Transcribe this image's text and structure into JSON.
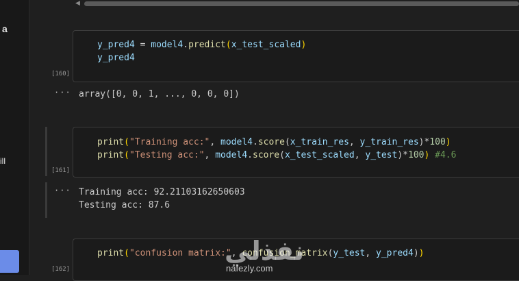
{
  "sidebar": {
    "fragment_top": "a",
    "fragment_mid": "ill"
  },
  "cells": [
    {
      "count": "[160]",
      "lines": [
        [
          [
            "y_pred4",
            "var"
          ],
          [
            " = ",
            ""
          ],
          [
            "model4",
            "var"
          ],
          [
            ".",
            ""
          ],
          [
            "predict",
            "fn"
          ],
          [
            "(",
            "pn"
          ],
          [
            "x_test_scaled",
            "var"
          ],
          [
            ")",
            "pn"
          ]
        ],
        [
          [
            "y_pred4",
            "var"
          ]
        ]
      ],
      "output": [
        "array([0, 0, 1, ..., 0, 0, 0])"
      ]
    },
    {
      "count": "[161]",
      "lines": [
        [
          [
            "print",
            "fn"
          ],
          [
            "(",
            "pn"
          ],
          [
            "\"Training acc:\"",
            "str"
          ],
          [
            ", ",
            ""
          ],
          [
            "model4",
            "var"
          ],
          [
            ".",
            ""
          ],
          [
            "score",
            "fn"
          ],
          [
            "(",
            ""
          ],
          [
            "x_train_res",
            "var"
          ],
          [
            ", ",
            ""
          ],
          [
            "y_train_res",
            "var"
          ],
          [
            ")",
            ""
          ],
          [
            "*",
            ""
          ],
          [
            "100",
            "num"
          ],
          [
            ")",
            "pn"
          ]
        ],
        [
          [
            "print",
            "fn"
          ],
          [
            "(",
            "pn"
          ],
          [
            "\"Testing acc:\"",
            "str"
          ],
          [
            ", ",
            ""
          ],
          [
            "model4",
            "var"
          ],
          [
            ".",
            ""
          ],
          [
            "score",
            "fn"
          ],
          [
            "(",
            ""
          ],
          [
            "x_test_scaled",
            "var"
          ],
          [
            ", ",
            ""
          ],
          [
            "y_test",
            "var"
          ],
          [
            ")",
            ""
          ],
          [
            "*",
            ""
          ],
          [
            "100",
            "num"
          ],
          [
            ")",
            "pn"
          ],
          [
            " #4.6",
            "cmt"
          ]
        ]
      ],
      "output": [
        "Training acc: 92.21103162650603",
        "Testing acc: 87.6"
      ]
    },
    {
      "count": "[162]",
      "lines": [
        [
          [
            "print",
            "fn"
          ],
          [
            "(",
            "pn"
          ],
          [
            "\"confusion matrix:\"",
            "str"
          ],
          [
            ", ",
            ""
          ],
          [
            "confusion_matrix",
            "fn"
          ],
          [
            "(",
            ""
          ],
          [
            "y_test",
            "var"
          ],
          [
            ", ",
            ""
          ],
          [
            "y_pred4",
            "var"
          ],
          [
            ")",
            ""
          ],
          [
            ")",
            "pn"
          ]
        ]
      ],
      "output": []
    }
  ],
  "output_marker": "···",
  "watermark": {
    "glyph": "نفذلي",
    "site": "nafezly.com"
  },
  "token_colors": {
    "fn": "#dcdcaa",
    "var": "#9cdcfe",
    "str": "#ce9178",
    "num": "#b5cea8",
    "cmt": "#6a9955",
    "pn": "#ffd700"
  }
}
